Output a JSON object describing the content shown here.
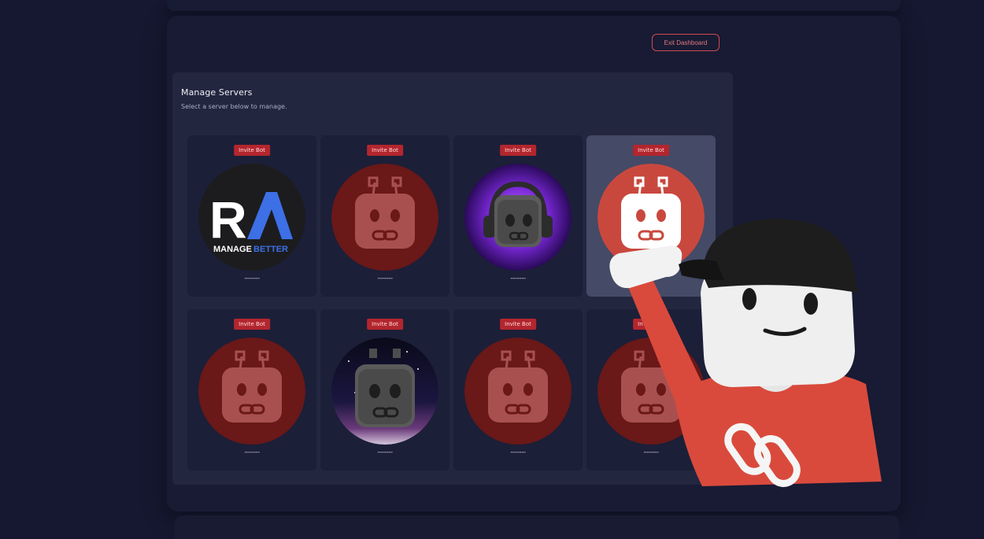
{
  "header": {
    "exit_label": "Exit Dashboard"
  },
  "panel": {
    "title": "Manage Servers",
    "subtitle": "Select a server below to manage."
  },
  "servers": [
    {
      "invite_label": "Invite Bot",
      "name": "-------",
      "icon": "ra-manage-better-logo",
      "selected": false
    },
    {
      "invite_label": "Invite Bot",
      "name": "-------",
      "icon": "robot-link-icon",
      "selected": false
    },
    {
      "invite_label": "Invite Bot",
      "name": "-------",
      "icon": "stone-robot-headphones-icon",
      "selected": false
    },
    {
      "invite_label": "Invite Bot",
      "name": "-------",
      "icon": "robot-link-icon",
      "selected": true
    },
    {
      "invite_label": "Invite Bot",
      "name": "-------",
      "icon": "robot-link-icon",
      "selected": false
    },
    {
      "invite_label": "Invite Bot",
      "name": "-------",
      "icon": "stone-robot-space-icon",
      "selected": false
    },
    {
      "invite_label": "Invite Bot",
      "name": "-------",
      "icon": "robot-link-icon",
      "selected": false
    },
    {
      "invite_label": "Invite Bot",
      "name": "-------",
      "icon": "robot-link-icon",
      "selected": false
    }
  ],
  "logo_text": {
    "main": "RA",
    "tagline_a": "MANAGE",
    "tagline_b": "BETTER"
  },
  "colors": {
    "background": "#151830",
    "panel": "#23263f",
    "card": "#1c1f38",
    "card_selected": "#454a66",
    "accent_red": "#b3262e",
    "exit_border": "#d04a54",
    "robot_red_dim": "#6a1818",
    "robot_red_bright": "#c9483e",
    "logo_blue": "#3d6fe6"
  }
}
